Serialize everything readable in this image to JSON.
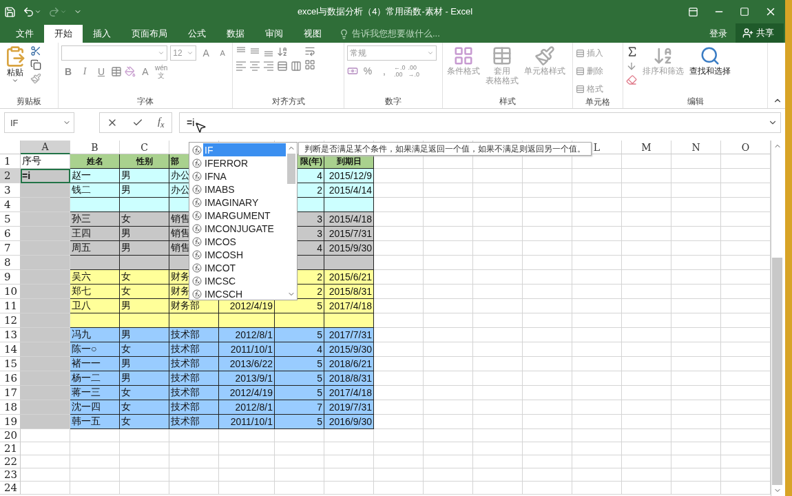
{
  "window": {
    "title": "excel与数据分析（4）常用函数-素材 - Excel"
  },
  "menu_tabs": [
    {
      "label": "文件",
      "selected": false
    },
    {
      "label": "开始",
      "selected": true
    },
    {
      "label": "插入",
      "selected": false
    },
    {
      "label": "页面布局",
      "selected": false
    },
    {
      "label": "公式",
      "selected": false
    },
    {
      "label": "数据",
      "selected": false
    },
    {
      "label": "审阅",
      "selected": false
    },
    {
      "label": "视图",
      "selected": false
    }
  ],
  "tell_me": {
    "placeholder": "告诉我您想要做什么..."
  },
  "sign_in": "登录",
  "share": "共享",
  "ribbon": {
    "clipboard": {
      "label": "剪贴板",
      "paste": "粘贴"
    },
    "font": {
      "label": "字体",
      "size": "12",
      "grow": "A",
      "shrink": "A",
      "bold": "B",
      "italic": "I",
      "underline": "U",
      "font_color": "A",
      "phonetic_top": "wén",
      "phonetic_bottom": "文"
    },
    "alignment": {
      "label": "对齐方式"
    },
    "number": {
      "label": "数字",
      "format": "常规",
      "percent": "%",
      "comma": ",",
      "increase_decimal": [
        "←.0",
        ".00"
      ],
      "decrease_decimal": [
        ".00",
        "→.0"
      ]
    },
    "styles": {
      "label": "样式",
      "buttons": [
        {
          "kind": "conditional",
          "lines": [
            "条件格式"
          ],
          "disabled": true
        },
        {
          "kind": "table",
          "lines": [
            "套用",
            "表格格式"
          ],
          "disabled": true
        },
        {
          "kind": "cell",
          "lines": [
            "单元格样式"
          ],
          "disabled": true
        }
      ]
    },
    "cells": {
      "label": "单元格",
      "buttons": [
        {
          "label": "插入",
          "disabled": true
        },
        {
          "label": "删除",
          "disabled": true
        },
        {
          "label": "格式",
          "disabled": true
        }
      ]
    },
    "editing": {
      "label": "编辑",
      "buttons": [
        {
          "kind": "sort",
          "label": "排序和筛选",
          "disabled": true
        },
        {
          "kind": "find",
          "label": "查找和选择",
          "disabled": false
        }
      ]
    }
  },
  "formula_bar": {
    "name_box": "IF",
    "fx": "f$_{x}$",
    "formula": "=i"
  },
  "sheet": {
    "columns_left": [
      {
        "label": "A",
        "selected": true
      },
      {
        "label": "B",
        "selected": false
      },
      {
        "label": "C",
        "selected": false
      }
    ],
    "columns_right": [
      {
        "label": "L",
        "selected": false
      },
      {
        "label": "M",
        "selected": false
      },
      {
        "label": "N",
        "selected": false
      },
      {
        "label": "O",
        "selected": false
      }
    ],
    "rows": [
      {
        "num": "1",
        "selected": false,
        "kind": "header",
        "color": "#a9d18e",
        "lead": {
          "text": "序号"
        },
        "col_b": "姓名",
        "col_c": "性别",
        "col_d": "部",
        "col_f": "限(年)",
        "col_g": "到期日"
      },
      {
        "num": "2",
        "selected": true,
        "kind": "data",
        "color": "#ccffff",
        "lead": {
          "color": "#c8c8c8",
          "text": "=i"
        },
        "col_b": "赵一",
        "col_c": "男",
        "col_d": "办公",
        "col_f": "4",
        "col_g": "2015/12/9"
      },
      {
        "num": "3",
        "selected": false,
        "kind": "data",
        "color": "#ccffff",
        "lead": {
          "color": "#c8c8c8"
        },
        "col_b": "钱二",
        "col_c": "男",
        "col_d": "办公",
        "col_f": "2",
        "col_g": "2015/4/14"
      },
      {
        "num": "4",
        "selected": false,
        "kind": "data",
        "color": "#ccffff",
        "lead": {
          "color": "#c8c8c8"
        }
      },
      {
        "num": "5",
        "selected": false,
        "kind": "data",
        "color": "#c8c8c8",
        "lead": {
          "color": "#c8c8c8"
        },
        "col_b": "孙三",
        "col_c": "女",
        "col_d": "销售",
        "col_f": "3",
        "col_g": "2015/4/18"
      },
      {
        "num": "6",
        "selected": false,
        "kind": "data",
        "color": "#c8c8c8",
        "lead": {
          "color": "#c8c8c8"
        },
        "col_b": "王四",
        "col_c": "男",
        "col_d": "销售",
        "col_f": "3",
        "col_g": "2015/7/31"
      },
      {
        "num": "7",
        "selected": false,
        "kind": "data",
        "color": "#c8c8c8",
        "lead": {
          "color": "#c8c8c8"
        },
        "col_b": "周五",
        "col_c": "男",
        "col_d": "销售",
        "col_f": "4",
        "col_g": "2015/9/30"
      },
      {
        "num": "8",
        "selected": false,
        "kind": "data",
        "color": "#c8c8c8",
        "lead": {
          "color": "#c8c8c8"
        }
      },
      {
        "num": "9",
        "selected": false,
        "kind": "data",
        "color": "#ffff99",
        "lead": {
          "color": "#c8c8c8"
        },
        "col_b": "吴六",
        "col_c": "女",
        "col_d": "财务",
        "col_f": "2",
        "col_g": "2015/6/21"
      },
      {
        "num": "10",
        "selected": false,
        "kind": "data",
        "color": "#ffff99",
        "lead": {
          "color": "#c8c8c8"
        },
        "col_b": "郑七",
        "col_c": "女",
        "col_d": "财务",
        "col_f": "2",
        "col_g": "2015/8/31"
      },
      {
        "num": "11",
        "selected": false,
        "kind": "data",
        "color": "#ffff99",
        "lead": {
          "color": "#c8c8c8"
        },
        "col_b": "卫八",
        "col_c": "男",
        "col_d": "财务部",
        "col_e": "2012/4/19",
        "col_f": "5",
        "col_g": "2017/4/18"
      },
      {
        "num": "12",
        "selected": false,
        "kind": "data",
        "color": "#ffff99",
        "lead": {
          "color": "#c8c8c8"
        }
      },
      {
        "num": "13",
        "selected": false,
        "kind": "data",
        "color": "#99ccff",
        "lead": {
          "color": "#c8c8c8"
        },
        "col_b": "冯九",
        "col_c": "男",
        "col_d": "技术部",
        "col_e": "2012/8/1",
        "col_f": "5",
        "col_g": "2017/7/31"
      },
      {
        "num": "14",
        "selected": false,
        "kind": "data",
        "color": "#99ccff",
        "lead": {
          "color": "#c8c8c8"
        },
        "col_b": "陈一○",
        "col_c": "女",
        "col_d": "技术部",
        "col_e": "2011/10/1",
        "col_f": "4",
        "col_g": "2015/9/30"
      },
      {
        "num": "15",
        "selected": false,
        "kind": "data",
        "color": "#99ccff",
        "lead": {
          "color": "#c8c8c8"
        },
        "col_b": "褚一一",
        "col_c": "男",
        "col_d": "技术部",
        "col_e": "2013/6/22",
        "col_f": "5",
        "col_g": "2018/6/21"
      },
      {
        "num": "16",
        "selected": false,
        "kind": "data",
        "color": "#99ccff",
        "lead": {
          "color": "#c8c8c8"
        },
        "col_b": "杨一二",
        "col_c": "男",
        "col_d": "技术部",
        "col_e": "2013/9/1",
        "col_f": "5",
        "col_g": "2018/8/31"
      },
      {
        "num": "17",
        "selected": false,
        "kind": "data",
        "color": "#99ccff",
        "lead": {
          "color": "#c8c8c8"
        },
        "col_b": "蒋一三",
        "col_c": "女",
        "col_d": "技术部",
        "col_e": "2012/4/19",
        "col_f": "5",
        "col_g": "2017/4/18"
      },
      {
        "num": "18",
        "selected": false,
        "kind": "data",
        "color": "#99ccff",
        "lead": {
          "color": "#c8c8c8"
        },
        "col_b": "沈一四",
        "col_c": "女",
        "col_d": "技术部",
        "col_e": "2012/8/1",
        "col_f": "7",
        "col_g": "2019/7/31"
      },
      {
        "num": "19",
        "selected": false,
        "kind": "data",
        "color": "#99ccff",
        "lead": {
          "color": "#c8c8c8"
        },
        "col_b": "韩一五",
        "col_c": "女",
        "col_d": "技术部",
        "col_e": "2011/10/1",
        "col_f": "5",
        "col_g": "2016/9/30"
      },
      {
        "num": "20",
        "selected": false,
        "kind": "blank"
      },
      {
        "num": "21",
        "selected": false,
        "kind": "blank"
      },
      {
        "num": "22",
        "selected": false,
        "kind": "blank"
      },
      {
        "num": "23",
        "selected": false,
        "kind": "blank"
      },
      {
        "num": "24",
        "selected": false,
        "kind": "blank"
      }
    ]
  },
  "autocomplete": {
    "items": [
      {
        "label": "IF",
        "selected": true
      },
      {
        "label": "IFERROR",
        "selected": false
      },
      {
        "label": "IFNA",
        "selected": false
      },
      {
        "label": "IMABS",
        "selected": false
      },
      {
        "label": "IMAGINARY",
        "selected": false
      },
      {
        "label": "IMARGUMENT",
        "selected": false
      },
      {
        "label": "IMCONJUGATE",
        "selected": false
      },
      {
        "label": "IMCOS",
        "selected": false
      },
      {
        "label": "IMCOSH",
        "selected": false
      },
      {
        "label": "IMCOT",
        "selected": false
      },
      {
        "label": "IMCSC",
        "selected": false
      },
      {
        "label": "IMCSCH",
        "selected": false
      }
    ],
    "tooltip": "判断是否满足某个条件，如果满足返回一个值，如果不满足则返回另一个值。"
  }
}
